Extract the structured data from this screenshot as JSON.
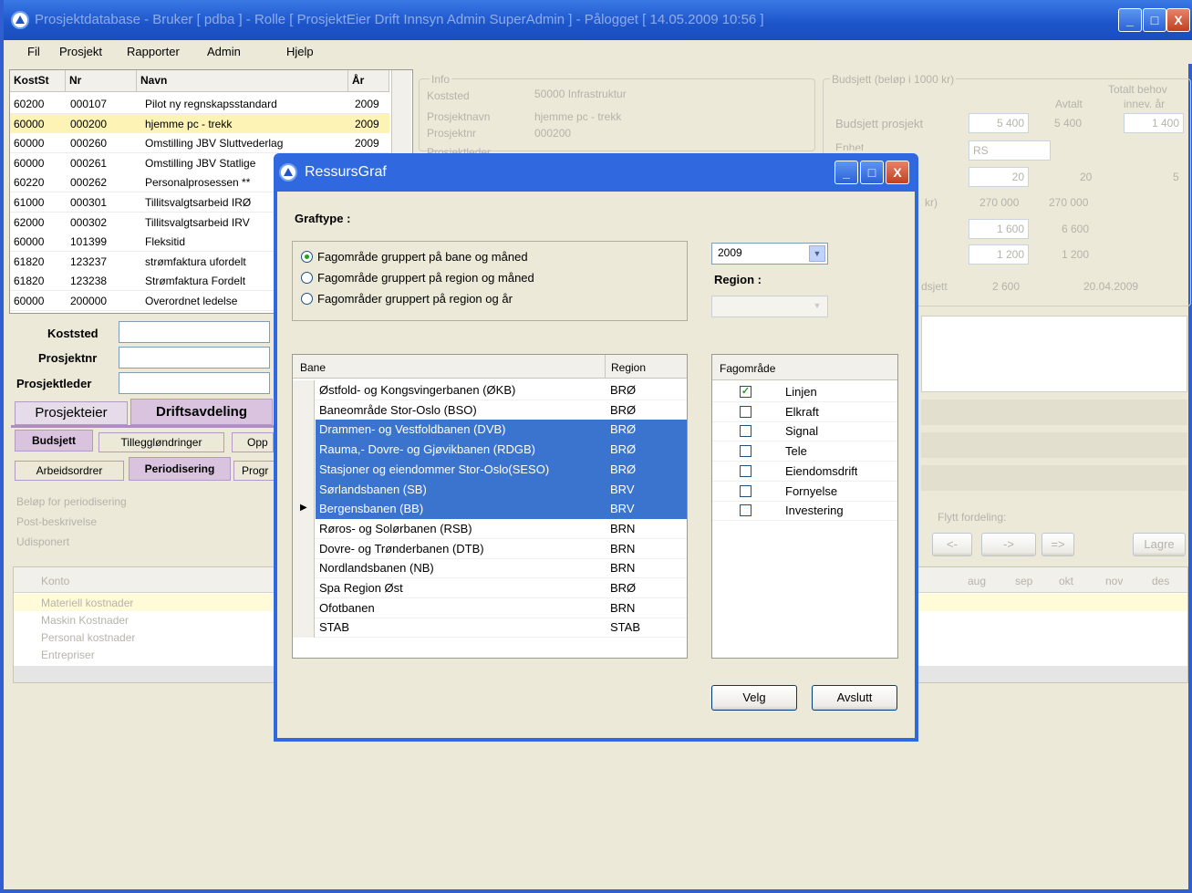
{
  "main_window": {
    "title": "Prosjektdatabase  -  Bruker [ pdba ]  -  Rolle [ ProsjektEier Drift Innsyn Admin SuperAdmin ]  -  Pålogget [ 14.05.2009 10:56 ]",
    "controls": {
      "minimize": "_",
      "maximize": "□",
      "close": "X"
    }
  },
  "menu": [
    "Fil",
    "Prosjekt",
    "Rapporter",
    "Admin",
    "Hjelp"
  ],
  "project_table": {
    "headers": [
      "KostSt",
      "Nr",
      "Navn",
      "År"
    ],
    "rows": [
      {
        "kostst": "60200",
        "nr": "000107",
        "navn": "Pilot ny regnskapsstandard",
        "ar": "2009"
      },
      {
        "kostst": "60000",
        "nr": "000200",
        "navn": "hjemme pc - trekk",
        "ar": "2009"
      },
      {
        "kostst": "60000",
        "nr": "000260",
        "navn": "Omstilling JBV Sluttvederlag",
        "ar": "2009"
      },
      {
        "kostst": "60000",
        "nr": "000261",
        "navn": "Omstilling JBV Statlige",
        "ar": ""
      },
      {
        "kostst": "60220",
        "nr": "000262",
        "navn": "Personalprosessen **",
        "ar": ""
      },
      {
        "kostst": "61000",
        "nr": "000301",
        "navn": "Tillitsvalgtsarbeid IRØ",
        "ar": ""
      },
      {
        "kostst": "62000",
        "nr": "000302",
        "navn": "Tillitsvalgtsarbeid IRV",
        "ar": ""
      },
      {
        "kostst": "60000",
        "nr": "101399",
        "navn": "Fleksitid",
        "ar": ""
      },
      {
        "kostst": "61820",
        "nr": "123237",
        "navn": "strømfaktura ufordelt",
        "ar": ""
      },
      {
        "kostst": "61820",
        "nr": "123238",
        "navn": "Strømfaktura Fordelt",
        "ar": ""
      },
      {
        "kostst": "60000",
        "nr": "200000",
        "navn": "Overordnet ledelse",
        "ar": ""
      }
    ]
  },
  "filters": {
    "koststed": "Koststed",
    "prosjektnr": "Prosjektnr",
    "prosjektleder": "Prosjektleder"
  },
  "tabs_top": [
    "Prosjekteier",
    "Driftsavdeling"
  ],
  "tabs_mid": [
    "Budsjett",
    "Tilleggløndringer",
    "Opp"
  ],
  "tabs_low": [
    "Arbeidsordrer",
    "Periodisering",
    "Progr"
  ],
  "period_labels": [
    "Beløp for periodisering",
    "Post-beskrivelse",
    "Udisponert"
  ],
  "konto": {
    "header": "Konto",
    "rows": [
      "Materiell kostnader",
      "Maskin Kostnader",
      "Personal kostnader",
      "Entrepriser"
    ]
  },
  "info": {
    "legend": "Info",
    "labels": [
      "Koststed",
      "Prosjektnavn",
      "Prosjektnr",
      "Prosjektleder"
    ],
    "values": [
      "50000  Infrastruktur",
      "hjemme pc - trekk",
      "000200"
    ]
  },
  "budsjett": {
    "legend": "Budsjett (beløp i 1000 kr)",
    "total_header": "Totalt behov",
    "total_sub": "innev. år",
    "avtalt": "Avtalt",
    "prosjekt_label": "Budsjett prosjekt",
    "prosjekt_value": "5 400",
    "avtalt_value": "5 400",
    "total_value": "1 400",
    "enhet_label": "Enhet",
    "enhet_value": "RS",
    "r1": "20",
    "r1b": "20",
    "r1c": "5",
    "r2a": "270 000",
    "r2b": "270 000",
    "r2_label": "kr)",
    "r3a": "1 600",
    "r3b": "6 600",
    "r4a": "1 200",
    "r4b": "1 200",
    "r5_label": "dsjett",
    "r5a": "2 600",
    "r5b": "20.04.2009"
  },
  "flytt": {
    "label": "Flytt fordeling:",
    "b1": "<-",
    "b2": "->",
    "b3": "=>",
    "lagre": "Lagre"
  },
  "months": [
    "aug",
    "sep",
    "okt",
    "nov",
    "des"
  ],
  "dialog": {
    "title": "RessursGraf",
    "graftype_label": "Graftype :",
    "options": [
      "Fagområde gruppert på bane og måned",
      "Fagområde gruppert på region og måned",
      "Fagområder gruppert på region og år"
    ],
    "selected_option": 0,
    "year": "2009",
    "region_label": "Region :",
    "region_value": "",
    "bane_headers": [
      "Bane",
      "Region"
    ],
    "bane_rows": [
      {
        "bane": "Østfold- og Kongsvingerbanen (ØKB)",
        "region": "BRØ",
        "selected": false
      },
      {
        "bane": "Baneområde Stor-Oslo (BSO)",
        "region": "BRØ",
        "selected": false
      },
      {
        "bane": "Drammen- og Vestfoldbanen (DVB)",
        "region": "BRØ",
        "selected": true
      },
      {
        "bane": "Rauma,- Dovre- og Gjøvikbanen (RDGB)",
        "region": "BRØ",
        "selected": true
      },
      {
        "bane": "Stasjoner og eiendommer Stor-Oslo(SESO)",
        "region": "BRØ",
        "selected": true
      },
      {
        "bane": "Sørlandsbanen (SB)",
        "region": "BRV",
        "selected": true
      },
      {
        "bane": "Bergensbanen (BB)",
        "region": "BRV",
        "selected": true
      },
      {
        "bane": "Røros- og Solørbanen (RSB)",
        "region": "BRN",
        "selected": false
      },
      {
        "bane": "Dovre- og Trønderbanen (DTB)",
        "region": "BRN",
        "selected": false
      },
      {
        "bane": "Nordlandsbanen (NB)",
        "region": "BRN",
        "selected": false
      },
      {
        "bane": "Spa Region Øst",
        "region": "BRØ",
        "selected": false
      },
      {
        "bane": "Ofotbanen",
        "region": "BRN",
        "selected": false
      },
      {
        "bane": "STAB",
        "region": "STAB",
        "selected": false
      }
    ],
    "fag_header": "Fagområde",
    "fag_rows": [
      {
        "name": "Linjen",
        "checked": true
      },
      {
        "name": "Elkraft",
        "checked": false
      },
      {
        "name": "Signal",
        "checked": false
      },
      {
        "name": "Tele",
        "checked": false
      },
      {
        "name": "Eiendomsdrift",
        "checked": false
      },
      {
        "name": "Fornyelse",
        "checked": false
      },
      {
        "name": "Investering",
        "checked": false
      }
    ],
    "velg": "Velg",
    "avslutt": "Avslutt"
  }
}
